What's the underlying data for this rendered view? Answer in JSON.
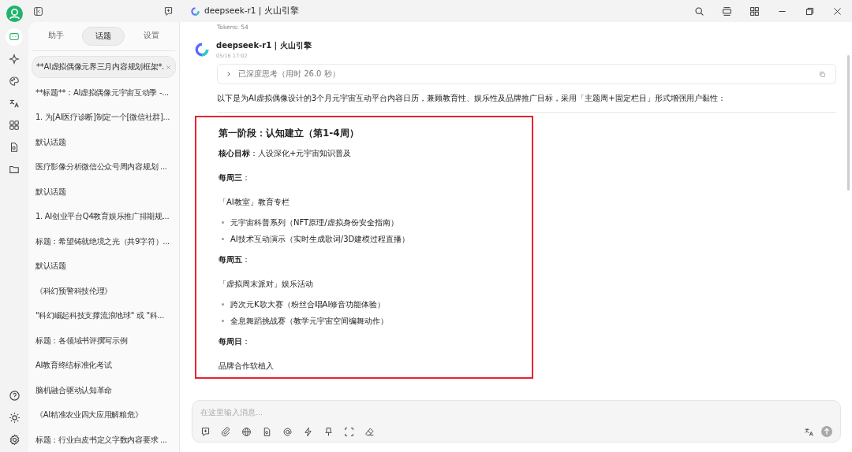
{
  "rail": [
    {
      "kind": "chat",
      "selected": true
    },
    {
      "kind": "sparkle",
      "selected": false
    },
    {
      "kind": "palette",
      "selected": false
    },
    {
      "kind": "translate",
      "selected": false
    },
    {
      "kind": "apps",
      "selected": false
    },
    {
      "kind": "document",
      "selected": false
    },
    {
      "kind": "folder",
      "selected": false
    }
  ],
  "sidebar": {
    "tabs": [
      {
        "label": "助手",
        "selected": false
      },
      {
        "label": "话题",
        "selected": true
      },
      {
        "label": "设置",
        "selected": false
      }
    ],
    "topics": [
      {
        "title": "**AI虚拟偶像元界三月内容规划框架*.",
        "selected": true
      },
      {
        "title": "**标题**：AI虚拟偶像元宇宙互动季 -...",
        "selected": false
      },
      {
        "title": "1. 为[AI医疗诊断]制定一个[微信社群]...",
        "selected": false
      },
      {
        "title": "默认话题",
        "selected": false
      },
      {
        "title": "医疗影像分析微信公众号周内容规划 ...",
        "selected": false
      },
      {
        "title": "默认话题",
        "selected": false
      },
      {
        "title": "1. AI创业平台Q4教育娱乐推广排期规...",
        "selected": false
      },
      {
        "title": "标题：希望铸就绝境之光（共9字符）...",
        "selected": false
      },
      {
        "title": "默认话题",
        "selected": false
      },
      {
        "title": "《科幻预警科技伦理》",
        "selected": false
      },
      {
        "title": "\"科幻崛起科技支撑流浪地球\" 或 \"科...",
        "selected": false
      },
      {
        "title": "标题：各领域书评撰写示例",
        "selected": false
      },
      {
        "title": "AI教育终结标准化考试",
        "selected": false
      },
      {
        "title": "脑机融合驱动认知革命",
        "selected": false
      },
      {
        "title": "《AI精准农业四大应用解粮危》",
        "selected": false
      },
      {
        "title": "标题：行业白皮书定义字数内容要求 ...",
        "selected": false
      }
    ]
  },
  "header": {
    "title": "deepseek-r1 | 火山引擎"
  },
  "message": {
    "tokens": "Tokens: 54",
    "model": "deepseek-r1 | 火山引擎",
    "time": "05/16 17:02",
    "thinking": {
      "label": "已深度思考（用时 26.0 秒）",
      "expanded": false
    },
    "intro": "以下是为AI虚拟偶像设计的3个月元宇宙互动平台内容日历，兼顾教育性、娱乐性及品牌推广目标，采用「主题周+固定栏目」形式增强用户黏性：",
    "section": {
      "heading": "第一阶段：认知建立（第1-4周）",
      "highlighted": true,
      "blocks": [
        {
          "kind": "para",
          "text": "**核心目标**：人设深化+元宇宙知识普及"
        },
        {
          "kind": "label",
          "text": "**每周三**："
        },
        {
          "kind": "para",
          "text": "「AI教室」教育专栏"
        },
        {
          "kind": "bullet",
          "text": "元宇宙科普系列（NFT原理/虚拟身份安全指南）"
        },
        {
          "kind": "bullet",
          "text": "AI技术互动演示（实时生成歌词/3D建模过程直播）"
        },
        {
          "kind": "label",
          "text": "**每周五**："
        },
        {
          "kind": "para",
          "text": "「虚拟周末派对」娱乐活动"
        },
        {
          "kind": "bullet",
          "text": "跨次元K歌大赛（粉丝合唱AI修音功能体验）"
        },
        {
          "kind": "bullet",
          "text": "全息舞蹈挑战赛（教学元宇宙空间编舞动作）"
        },
        {
          "kind": "label",
          "text": "**每周日**："
        },
        {
          "kind": "para",
          "text": "品牌合作软植入"
        }
      ]
    }
  },
  "composer": {
    "placeholder": "在这里输入消息...",
    "tools": [
      {
        "kind": "topic"
      },
      {
        "kind": "attach"
      },
      {
        "kind": "web"
      },
      {
        "kind": "doc"
      },
      {
        "kind": "mention"
      },
      {
        "kind": "flash"
      },
      {
        "kind": "pin"
      },
      {
        "kind": "fullscreen"
      },
      {
        "kind": "clear"
      }
    ]
  }
}
